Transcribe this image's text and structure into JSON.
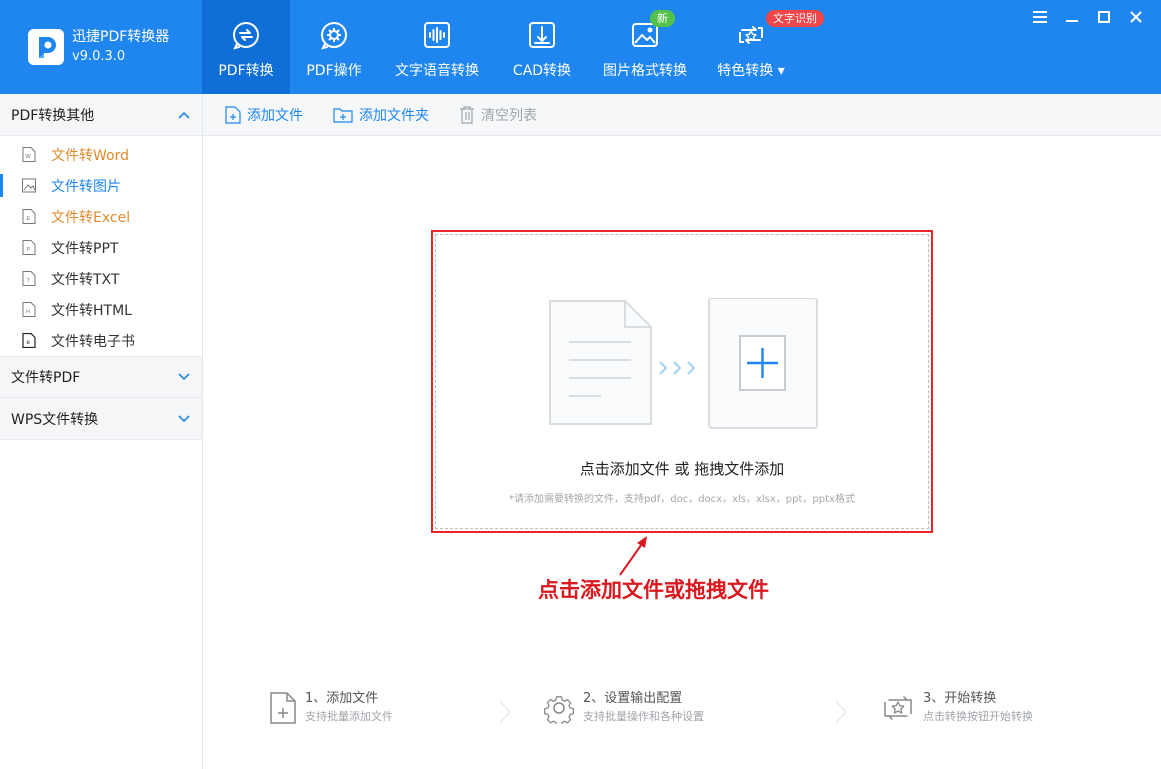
{
  "app": {
    "name": "迅捷PDF转换器",
    "version": "v9.0.3.0"
  },
  "colors": {
    "brand_blue": "#1f86f0",
    "nav_active": "#0f6fd6",
    "accent_orange": "#e08a2c",
    "annotation_red": "#d9191f"
  },
  "nav": {
    "items": [
      {
        "label": "PDF转换",
        "icon": "pdf-convert-icon",
        "active": true
      },
      {
        "label": "PDF操作",
        "icon": "pdf-operation-icon",
        "active": false
      },
      {
        "label": "文字语音转换",
        "icon": "text-voice-icon",
        "active": false
      },
      {
        "label": "CAD转换",
        "icon": "cad-icon",
        "active": false
      },
      {
        "label": "图片格式转换",
        "icon": "image-format-icon",
        "active": false,
        "badge": "新"
      },
      {
        "label": "特色转换",
        "icon": "special-convert-icon",
        "active": false,
        "badge": "文字识别"
      }
    ]
  },
  "sidebar": {
    "group1": {
      "title": "PDF转换其他"
    },
    "items": [
      {
        "label": "文件转Word",
        "icon_letter": "W"
      },
      {
        "label": "文件转图片",
        "icon_letter": ""
      },
      {
        "label": "文件转Excel",
        "icon_letter": "E"
      },
      {
        "label": "文件转PPT",
        "icon_letter": "P"
      },
      {
        "label": "文件转TXT",
        "icon_letter": "T"
      },
      {
        "label": "文件转HTML",
        "icon_letter": "H"
      },
      {
        "label": "文件转电子书",
        "icon_letter": "e"
      }
    ],
    "group2": {
      "title": "文件转PDF"
    },
    "group3": {
      "title": "WPS文件转换"
    }
  },
  "toolbar": {
    "add_file": "添加文件",
    "add_folder": "添加文件夹",
    "clear_list": "清空列表"
  },
  "dropzone": {
    "title": "点击添加文件 或 拖拽文件添加",
    "hint": "*请添加需要转换的文件，支持pdf，doc，docx，xls，xlsx，ppt，pptx格式"
  },
  "annotation": {
    "text": "点击添加文件或拖拽文件"
  },
  "steps": [
    {
      "title": "1、添加文件",
      "sub": "支持批量添加文件",
      "icon": "add-file-step-icon"
    },
    {
      "title": "2、设置输出配置",
      "sub": "支持批量操作和各种设置",
      "icon": "settings-gear-icon"
    },
    {
      "title": "3、开始转换",
      "sub": "点击转换按钮开始转换",
      "icon": "start-convert-icon"
    }
  ]
}
